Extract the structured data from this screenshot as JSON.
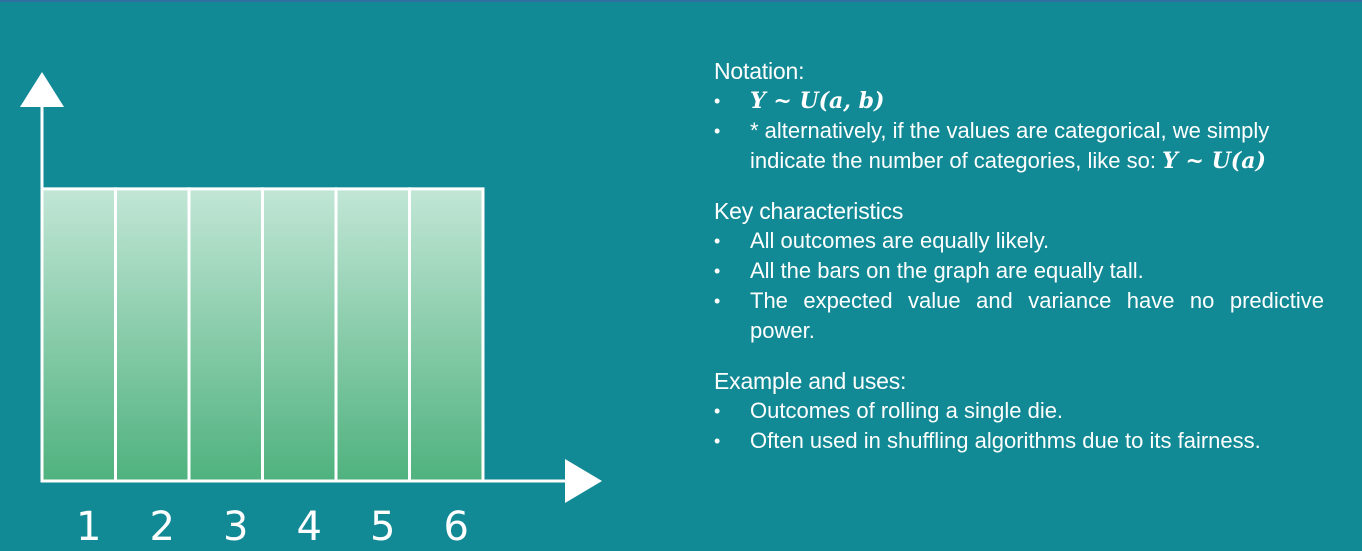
{
  "chart_data": {
    "type": "bar",
    "categories": [
      "1",
      "2",
      "3",
      "4",
      "5",
      "6"
    ],
    "values": [
      1,
      1,
      1,
      1,
      1,
      1
    ],
    "title": "",
    "xlabel": "",
    "ylabel": "",
    "ylim": [
      0,
      1.4
    ],
    "grid": false,
    "legend": "none",
    "bar_color_top": "#c2e6d6",
    "bar_color_bottom": "#4fb27e",
    "bar_stroke": "#ffffff",
    "axis_color": "#ffffff"
  },
  "notation": {
    "title": "Notation:",
    "items": [
      {
        "math": "Y ~ U(a, b)"
      },
      {
        "text": "* alternatively, if the values are categorical, we simply indicate the number of categories, like so:",
        "math": "Y ~ U(a)"
      }
    ]
  },
  "characteristics": {
    "title": "Key characteristics",
    "items": [
      "All outcomes are equally likely.",
      "All the bars on the graph are equally tall.",
      "The expected value and variance have no predictive power."
    ]
  },
  "examples": {
    "title": "Example and uses:",
    "items": [
      "Outcomes of rolling a single die.",
      "Often used in shuffling algorithms due to its fairness."
    ]
  }
}
